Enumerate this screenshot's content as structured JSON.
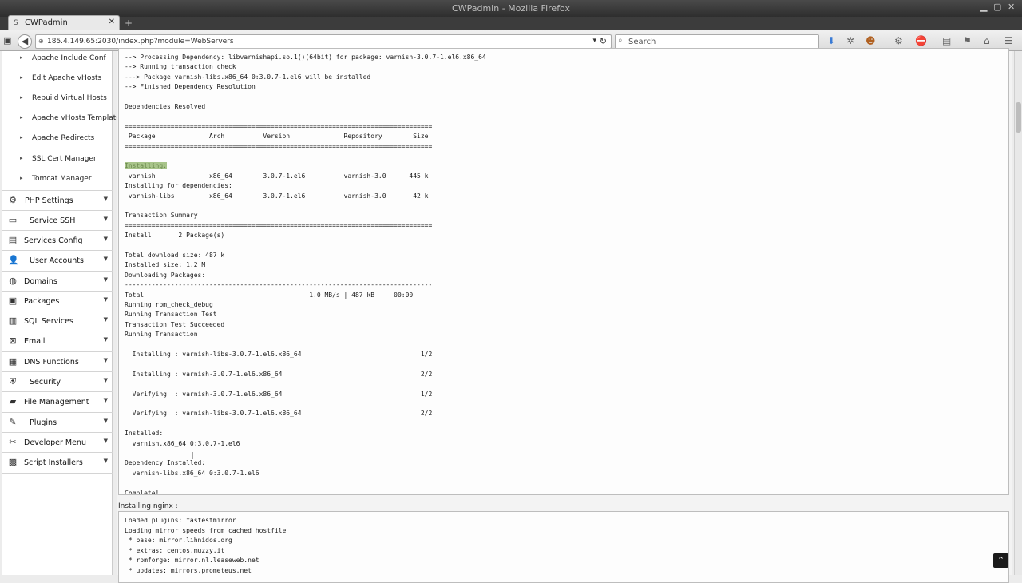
{
  "window": {
    "title": "CWPadmin - Mozilla Firefox"
  },
  "tab": {
    "label": "CWPadmin",
    "close": "✕",
    "newtab": "+"
  },
  "navbar": {
    "url": "185.4.149.65:2030/index.php?module=WebServers",
    "search_placeholder": "Search"
  },
  "sidebar": {
    "subitems": [
      {
        "label": "Apache Include Conf"
      },
      {
        "label": "Edit Apache vHosts"
      },
      {
        "label": "Rebuild Virtual Hosts"
      },
      {
        "label": "Apache vHosts Template"
      },
      {
        "label": "Apache Redirects"
      },
      {
        "label": "SSL Cert Manager"
      },
      {
        "label": "Tomcat Manager"
      }
    ],
    "items": [
      {
        "label": "PHP Settings",
        "icon": "gear-icon"
      },
      {
        "label": "Service SSH",
        "icon": "monitor-icon"
      },
      {
        "label": "Services Config",
        "icon": "server-icon"
      },
      {
        "label": "User Accounts",
        "icon": "user-icon"
      },
      {
        "label": "Domains",
        "icon": "globe-icon"
      },
      {
        "label": "Packages",
        "icon": "box-icon"
      },
      {
        "label": "SQL Services",
        "icon": "database-icon"
      },
      {
        "label": "Email",
        "icon": "envelope-icon"
      },
      {
        "label": "DNS Functions",
        "icon": "dns-icon"
      },
      {
        "label": "Security",
        "icon": "shield-icon"
      },
      {
        "label": "File Management",
        "icon": "folder-icon"
      },
      {
        "label": "Plugins",
        "icon": "plug-icon"
      },
      {
        "label": "Developer Menu",
        "icon": "wrench-icon"
      },
      {
        "label": "Script Installers",
        "icon": "installer-icon"
      }
    ]
  },
  "terminal1": {
    "lines": [
      "--> Processing Dependency: libvarnishapi.so.1()(64bit) for package: varnish-3.0.7-1.el6.x86_64",
      "--> Running transaction check",
      "---> Package varnish-libs.x86_64 0:3.0.7-1.el6 will be installed",
      "--> Finished Dependency Resolution",
      "",
      "Dependencies Resolved",
      "",
      "================================================================================",
      " Package              Arch          Version              Repository        Size",
      "================================================================================",
      "",
      " varnish              x86_64        3.0.7-1.el6          varnish-3.0      445 k",
      "Installing for dependencies:",
      " varnish-libs         x86_64        3.0.7-1.el6          varnish-3.0       42 k",
      "",
      "Transaction Summary",
      "================================================================================",
      "Install       2 Package(s)",
      "",
      "Total download size: 487 k",
      "Installed size: 1.2 M",
      "Downloading Packages:",
      "--------------------------------------------------------------------------------",
      "Total                                           1.0 MB/s | 487 kB     00:00",
      "Running rpm_check_debug",
      "Running Transaction Test",
      "Transaction Test Succeeded",
      "Running Transaction",
      "",
      "  Installing : varnish-libs-3.0.7-1.el6.x86_64                               1/2",
      "",
      "  Installing : varnish-3.0.7-1.el6.x86_64                                    2/2",
      "",
      "  Verifying  : varnish-3.0.7-1.el6.x86_64                                    1/2",
      "",
      "  Verifying  : varnish-libs-3.0.7-1.el6.x86_64                               2/2",
      "",
      "Installed:",
      "  varnish.x86_64 0:3.0.7-1.el6",
      "",
      "Dependency Installed:",
      "  varnish-libs.x86_64 0:3.0.7-1.el6",
      "",
      "Complete!"
    ],
    "highlight_line": "Installing:"
  },
  "installing_nginx_label": "Installing nginx :",
  "terminal2": {
    "lines": [
      "Loaded plugins: fastestmirror",
      "Loading mirror speeds from cached hostfile",
      " * base: mirror.lihnidos.org",
      " * extras: centos.muzzy.it",
      " * rpmforge: mirror.nl.leaseweb.net",
      " * updates: mirrors.prometeus.net"
    ]
  }
}
